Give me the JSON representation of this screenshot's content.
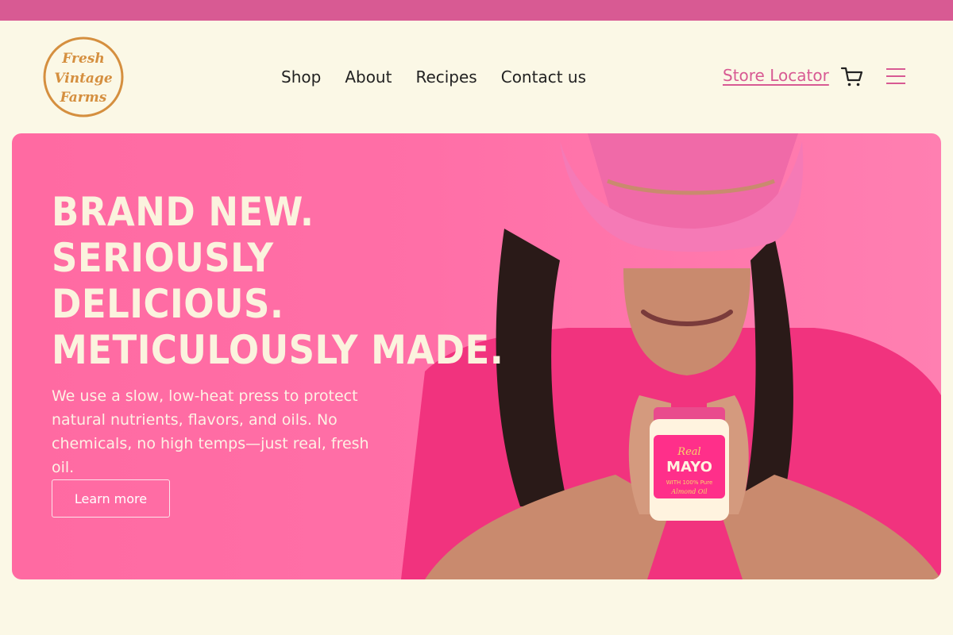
{
  "brand": {
    "name": "Fresh Vintage Farms"
  },
  "nav": {
    "items": [
      "Shop",
      "About",
      "Recipes",
      "Contact us"
    ]
  },
  "header": {
    "store_locator": "Store Locator"
  },
  "hero": {
    "headline": [
      "BRAND NEW.",
      "SERIOUSLY",
      "DELICIOUS.",
      "METICULOUSLY MADE."
    ],
    "body": "We use a slow, low-heat press to protect natural nutrients, flavors, and oils. No chemicals, no high temps—just real, fresh oil.",
    "cta": "Learn more",
    "jar_label": {
      "script": "Real",
      "title": "MAYO",
      "line1": "WITH 100% Pure",
      "line2": "Almond Oil"
    }
  },
  "colors": {
    "accent": "#d85a93",
    "hero_bg": "#ff6fa7",
    "page_bg": "#fbf8e6",
    "logo": "#d58f3f"
  },
  "icons": [
    "logo",
    "cart-icon",
    "menu-icon"
  ]
}
